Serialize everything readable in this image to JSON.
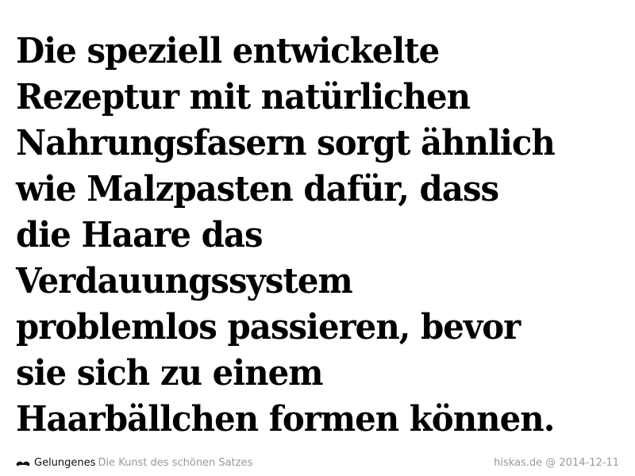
{
  "quote": {
    "lines": [
      "Die speziell entwickelte",
      "Rezeptur mit natürlichen",
      "Nahrungsfasern sorgt ähnlich",
      "wie Malzpasten dafür, dass",
      "die Haare das",
      "Verdauungssystem",
      "problemlos passieren, bevor",
      "sie sich zu einem",
      "Haarbällchen formen können."
    ]
  },
  "footer": {
    "icon": "mustache-icon",
    "brand_name": "Gelungenes",
    "brand_tagline": "Die Kunst des schönen Satzes",
    "attribution": "hiskas.de @ 2014-12-11"
  }
}
